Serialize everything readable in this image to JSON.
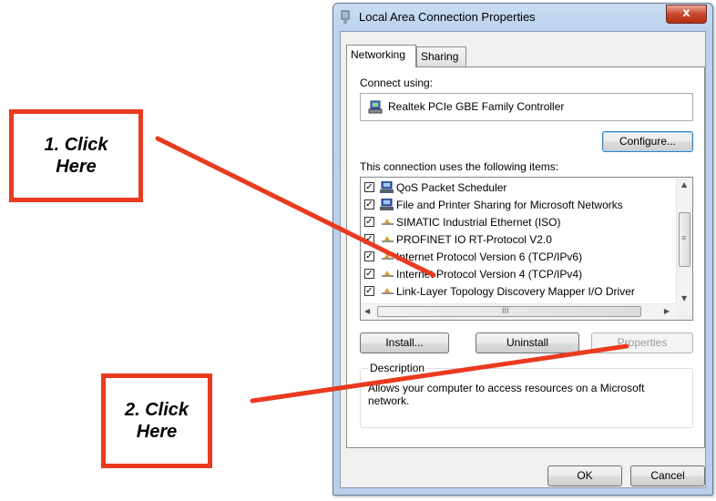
{
  "callouts": {
    "first": "1. Click\nHere",
    "second": "2. Click\nHere"
  },
  "colors": {
    "callout_red": "#ea3a1f"
  },
  "window": {
    "title": "Local Area Connection Properties",
    "close_label": "x"
  },
  "tabs": [
    {
      "label": "Networking",
      "selected": true
    },
    {
      "label": "Sharing",
      "selected": false
    }
  ],
  "networking": {
    "connect_using_label": "Connect using:",
    "adapter_name": "Realtek PCIe GBE Family Controller",
    "configure_button": "Configure...",
    "items_label": "This connection uses the following items:",
    "items": [
      {
        "label": "QoS Packet Scheduler",
        "checked": true,
        "icon": "network-client-icon"
      },
      {
        "label": "File and Printer Sharing for Microsoft Networks",
        "checked": true,
        "icon": "network-client-icon"
      },
      {
        "label": "SIMATIC Industrial Ethernet (ISO)",
        "checked": true,
        "icon": "protocol-icon"
      },
      {
        "label": "PROFINET IO RT-Protocol V2.0",
        "checked": true,
        "icon": "protocol-icon"
      },
      {
        "label": "Internet Protocol Version 6 (TCP/IPv6)",
        "checked": true,
        "icon": "protocol-icon"
      },
      {
        "label": "Internet Protocol Version 4 (TCP/IPv4)",
        "checked": true,
        "icon": "protocol-icon"
      },
      {
        "label": "Link-Layer Topology Discovery Mapper I/O Driver",
        "checked": true,
        "icon": "protocol-icon"
      }
    ],
    "hscroll_thumb_glyph": "III",
    "vscroll_thumb_glyph": "≡",
    "install_button": "Install...",
    "uninstall_button": "Uninstall",
    "properties_button": "Properties",
    "description_title": "Description",
    "description_text": "Allows your computer to access resources on a Microsoft network."
  },
  "footer": {
    "ok_button": "OK",
    "cancel_button": "Cancel"
  }
}
